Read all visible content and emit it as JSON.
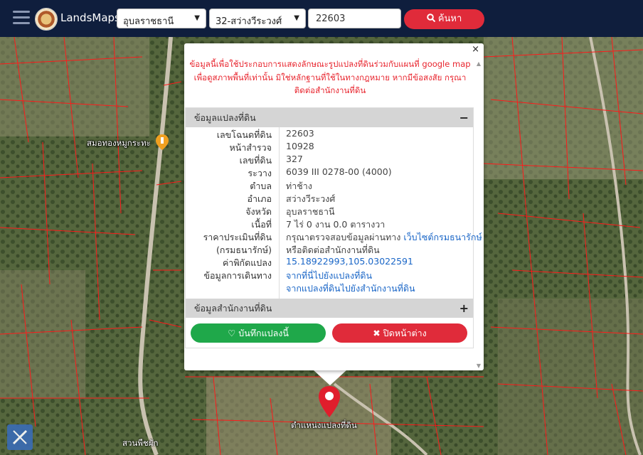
{
  "app": {
    "name": "LandsMaps"
  },
  "search": {
    "province": "อุบลราชธานี",
    "district": "32-สว่างวีระวงศ์",
    "parcel_number": "22603",
    "button_label": "ค้นหา"
  },
  "popup": {
    "close_label": "×",
    "notice": [
      "ข้อมูลนี้เพื่อใช้ประกอบการแสดงลักษณะรูปแปลงที่ดินร่วมกับแผนที่ google map",
      "เพื่อดูสภาพพื้นที่เท่านั้น มิใช่หลักฐานที่ใช้ในทางกฎหมาย หากมีข้อสงสัย กรุณา",
      "ติดต่อสำนักงานที่ดิน"
    ],
    "section_parcel": "ข้อมูลแปลงที่ดิน",
    "section_parcel_toggle": "−",
    "section_office": "ข้อมูลสำนักงานที่ดิน",
    "section_office_toggle": "+",
    "rows": [
      {
        "label": "เลขโฉนดที่ดิน",
        "value": "22603"
      },
      {
        "label": "หน้าสำรวจ",
        "value": "10928"
      },
      {
        "label": "เลขที่ดิน",
        "value": "327"
      },
      {
        "label": "ระวาง",
        "value": "6039 III 0278-00 (4000)"
      },
      {
        "label": "ตำบล",
        "value": "ท่าช้าง"
      },
      {
        "label": "อำเภอ",
        "value": "สว่างวีระวงศ์"
      },
      {
        "label": "จังหวัด",
        "value": "อุบลราชธานี"
      },
      {
        "label": "เนื้อที่",
        "value": "7 ไร่ 0 งาน 0.0 ตารางวา"
      },
      {
        "label": "ราคาประเมินที่ดิน",
        "value": "กรุณาตรวจสอบข้อมูลผ่านทาง",
        "link": "เว็บไซต์กรมธนารักษ์"
      },
      {
        "label": "(กรมธนารักษ์)",
        "value": "หรือติดต่อสำนักงานที่ดิน"
      },
      {
        "label": "ค่าพิกัดแปลง",
        "link": "15.18922993,105.03022591"
      },
      {
        "label": "ข้อมูลการเดินทาง",
        "link": "จากที่นี่ไปยังแปลงที่ดิน"
      },
      {
        "label": "",
        "link": "จากแปลงที่ดินไปยังสำนักงานที่ดิน"
      }
    ],
    "save_button": "บันทึกแปลงนี้",
    "close_button": "ปิดหน้าต่าง"
  },
  "map": {
    "marker_label": "ตำแหน่งแปลงที่ดิน",
    "poi_label": "สมอทองหมูกระทะ",
    "poi2_label": "สวนพืชผัก"
  },
  "colors": {
    "topbar": "#0f1e3d",
    "search": "#e02b3a",
    "save": "#1fa84a",
    "notice": "#e8252e",
    "link": "#1a66c7"
  }
}
